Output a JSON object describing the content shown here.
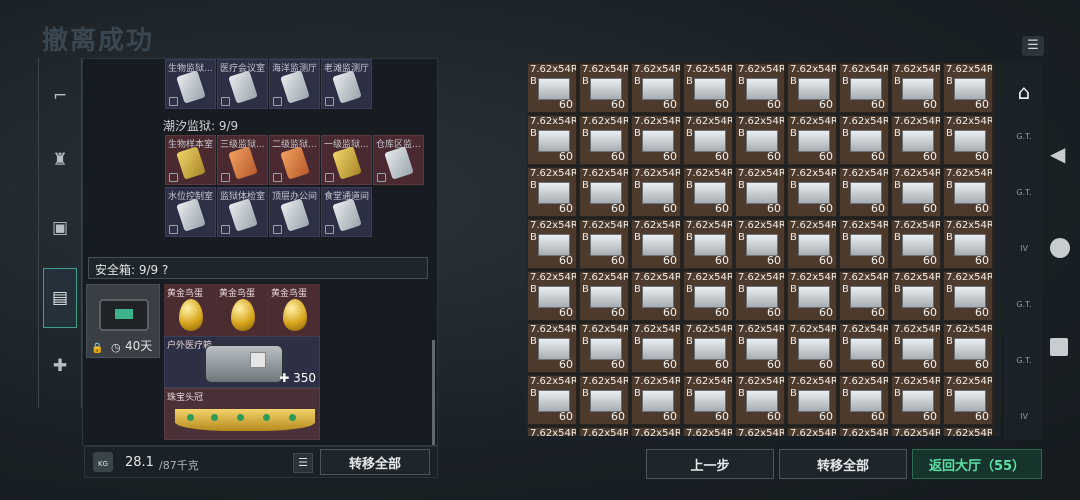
{
  "header": {
    "title": "撤离成功"
  },
  "left_panel": {
    "top_row_items": [
      {
        "label": "生物监狱..."
      },
      {
        "label": "医疗会议室"
      },
      {
        "label": "海洋监测厅"
      },
      {
        "label": "老滩监测厅"
      }
    ],
    "section_title": "潮汐监狱: 9/9",
    "tide_items": [
      {
        "label": "生物样本室"
      },
      {
        "label": "三级监狱..."
      },
      {
        "label": "二级监狱..."
      },
      {
        "label": "一级监狱..."
      },
      {
        "label": "仓库区监..."
      },
      {
        "label": "水位控制室"
      },
      {
        "label": "监狱体检室"
      },
      {
        "label": "顶层办公间"
      },
      {
        "label": "食堂通道间"
      }
    ],
    "safe_box": {
      "label": "安全箱: 9/9 ?",
      "timer": "40天"
    },
    "safe_items": {
      "egg_label": "黄金鸟蛋",
      "medkit_label": "户外医疗箱",
      "medkit_amount": "350",
      "crown_label": "珠宝头冠"
    },
    "weight": {
      "value": "28.1",
      "max": "/87千克",
      "icon_label": "KG"
    },
    "transfer_all": "转移全部"
  },
  "right_panel": {
    "ammo_label_top": "7.62x54R",
    "ammo_label_bottom": "B",
    "ammo_count": "60",
    "rows": 8,
    "cols": 9
  },
  "right_sidebar": {
    "items": [
      "G.T.",
      "G.T.",
      "IV",
      "G.T.",
      "G.T.",
      "IV"
    ]
  },
  "bottom_buttons": {
    "prev": "上一步",
    "transfer_all": "转移全部",
    "return": "返回大厅（55）"
  },
  "colors": {
    "accent": "#3f9d8a",
    "return_green": "#5fe0a8",
    "item_red": "#4a2c31"
  }
}
